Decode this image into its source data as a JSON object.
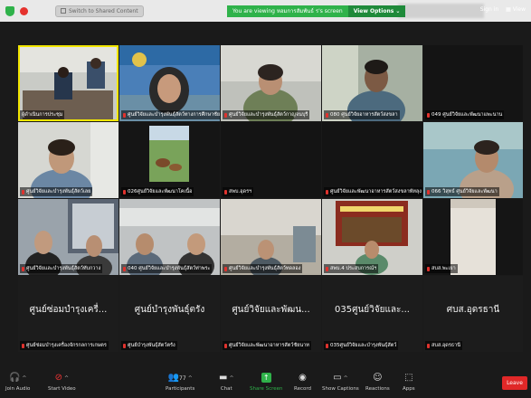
{
  "topbar": {
    "switch_label": "Switch to Shared Content",
    "banner_text": "You are viewing หอมการสัมพันธ์ ร's screen",
    "view_options": "View Options",
    "sign_in": "Sign in",
    "view": "View"
  },
  "tiles": [
    {
      "name": "ผู้ดำเนินการประชุม"
    },
    {
      "name": "ศูนย์วิจัยและบำรุงพันธุ์สัตว์ทางการศึกษาชัยภูมิ"
    },
    {
      "name": "ศูนย์วิจัยและบำรุงพันธุ์สัตว์กาญจนบุรี"
    },
    {
      "name": "080 ศูนย์วิจัยอาหารสัตว์สงขลา"
    },
    {
      "name": "049 ศูนย์วิจัยและพัฒนาแพะนาน"
    },
    {
      "name": "ศูนย์วิจัยและบำรุงพันธุ์สัตว์เลย"
    },
    {
      "name": "026ศูนย์วิจัยและพัฒนาโคเนื้อ"
    },
    {
      "name": "สพบ.อุดรฯ"
    },
    {
      "name": "ศูนย์วิจัยและพัฒนาอาหารสัตว์สงขลาพัทลุง"
    },
    {
      "name": "066 วิสุทธ์ ศูนย์วิจัยและพัฒนา"
    },
    {
      "name": "ศูนย์วิจัยและบำรุงพันธุ์สัตว์ทับกวาง"
    },
    {
      "name": "040 ศูนย์วิจัยและบำรุงพันธุ์สัตว์ท่าพระ"
    },
    {
      "name": "ศูนย์วิจัยและบำรุงพันธุ์สัตว์ทดลอง"
    },
    {
      "name": "สพบ.4 ประสบการณ์ฯ"
    },
    {
      "name": "สบส.พะเยา"
    },
    {
      "name": "ศูนย์ซ่อมบำรุงเครื่องจักรกลการเกษตร",
      "big": "ศูนย์ซ่อมบำรุงเครื่..."
    },
    {
      "name": "ศูนย์บำรุงพันธุ์สัตว์ตรัง",
      "big": "ศูนย์บำรุงพันธุ์ตรัง"
    },
    {
      "name": "ศูนย์วิจัยและพัฒนาอาหารสัตว์ชัยนาท",
      "big": "ศูนย์วิจัยและพัฒน..."
    },
    {
      "name": "035ศูนย์วิจัยและบำรุงพันธุ์สัตว์",
      "big": "035ศูนย์วิจัยและ..."
    },
    {
      "name": "สบส.อุดรธานี",
      "big": "ศบส.อุดรธานี"
    }
  ],
  "toolbar": {
    "join_audio": "Join Audio",
    "start_video": "Start Video",
    "participants": "Participants",
    "participants_count": "77",
    "chat": "Chat",
    "share_screen": "Share Screen",
    "record": "Record",
    "show_captions": "Show Captions",
    "reactions": "Reactions",
    "apps": "Apps",
    "leave": "Leave"
  },
  "colors": {
    "banner_green": "#2fb24a",
    "share_green": "#2fb24a",
    "leave_red": "#e02828",
    "active_speaker": "#f2e600"
  }
}
